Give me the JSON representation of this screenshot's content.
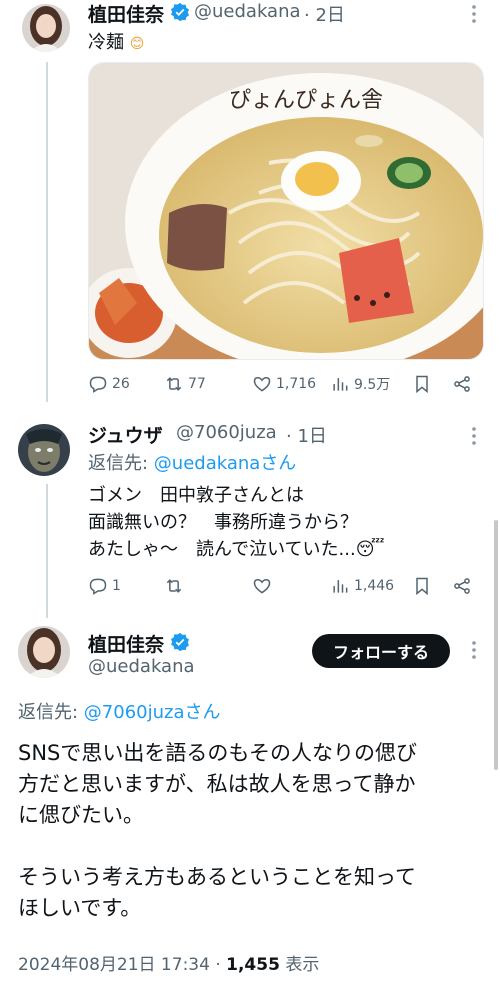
{
  "tweet1": {
    "name": "植田佳奈",
    "handle": "@uedakana",
    "time": "· 2日",
    "text": "冷麺",
    "emoji": "😊",
    "image_sign_text": "ぴょんぴょん舎",
    "stats": {
      "replies": "26",
      "retweets": "77",
      "likes": "1,716",
      "views": "9.5万"
    }
  },
  "tweet2": {
    "name": "ジュウザ",
    "handle": "@7060juza",
    "time": "· 1日",
    "reply_prefix": "返信先: ",
    "reply_to": "@uedakanaさん",
    "lines": [
      "ゴメン　田中敦子さんとは",
      "面識無いの？　事務所違うから？",
      "あたしゃ～　読んで泣いていた..."
    ],
    "emoji": "😴",
    "stats": {
      "replies": "1",
      "retweets": "",
      "likes": "",
      "views": "1,446"
    }
  },
  "tweet3": {
    "name": "植田佳奈",
    "handle": "@uedakana",
    "follow_label": "フォローする",
    "reply_prefix": "返信先: ",
    "reply_to": "@7060juzaさん",
    "lines": [
      "SNSで思い出を語るのもその人なりの偲び",
      "方だと思いますが、私は故人を思って静か",
      "に偲びたい。",
      "",
      "そういう考え方もあるということを知って",
      "ほしいです。"
    ],
    "date": "2024年08月21日 17:34 · ",
    "views_count": "1,455",
    "views_label": " 表示"
  },
  "colors": {
    "accent": "#1d9bf0",
    "text": "#0f1419",
    "muted": "#536471"
  },
  "icons": [
    "verified-icon",
    "more-icon",
    "reply-icon",
    "retweet-icon",
    "like-icon",
    "views-icon",
    "bookmark-icon",
    "share-icon"
  ]
}
